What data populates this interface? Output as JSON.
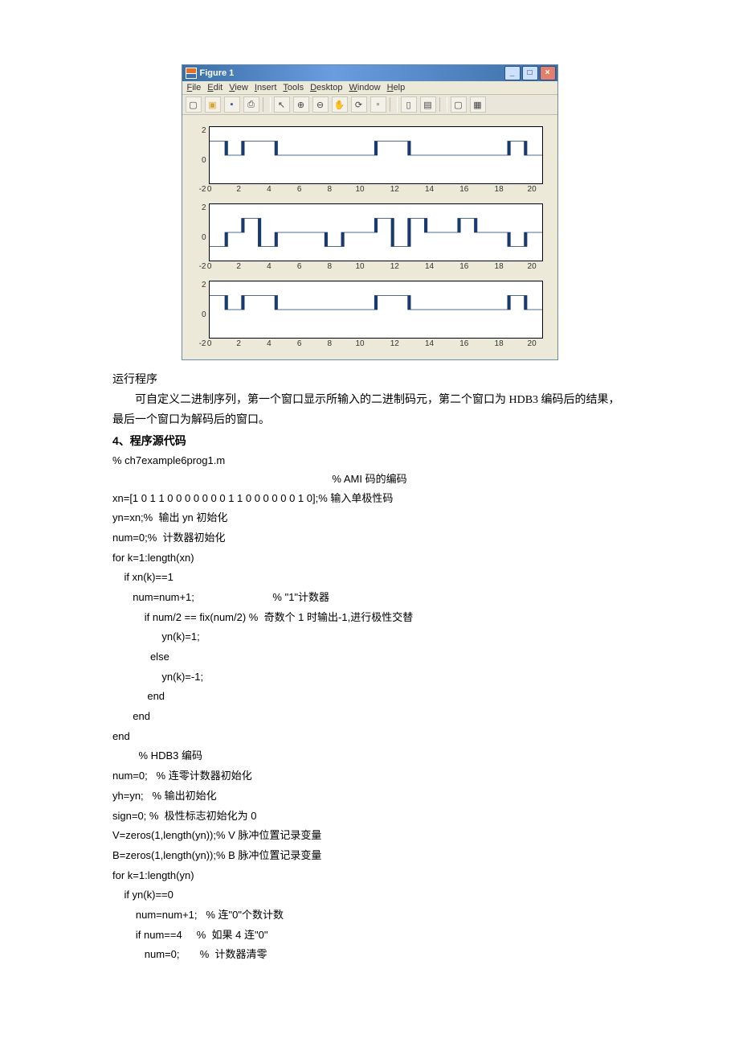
{
  "figure": {
    "title": "Figure 1",
    "menubar": [
      "File",
      "Edit",
      "View",
      "Insert",
      "Tools",
      "Desktop",
      "Window",
      "Help"
    ],
    "toolbar_icons": [
      "new-file-icon",
      "open-icon",
      "save-icon",
      "print-icon",
      "pointer-icon",
      "zoom-in-icon",
      "zoom-out-icon",
      "pan-icon",
      "rotate-icon",
      "data-cursor-icon",
      "colorbar-icon",
      "legend-icon",
      "hide-plot-tools-icon",
      "show-plot-tools-icon"
    ],
    "winbtns": {
      "min": "_",
      "max": "□",
      "close": "×"
    }
  },
  "chart_data": [
    {
      "type": "line",
      "title": "",
      "xlabel": "",
      "ylabel": "",
      "xlim": [
        0,
        20
      ],
      "ylim": [
        -2,
        2
      ],
      "xticks": [
        0,
        2,
        4,
        6,
        8,
        10,
        12,
        14,
        16,
        18,
        20
      ],
      "yticks": [
        -2,
        0,
        2
      ],
      "x": [
        0,
        1,
        1,
        2,
        2,
        3,
        3,
        4,
        4,
        5,
        5,
        6,
        6,
        7,
        7,
        8,
        8,
        9,
        9,
        10,
        10,
        11,
        11,
        12,
        12,
        13,
        13,
        14,
        14,
        15,
        15,
        16,
        16,
        17,
        17,
        18,
        18,
        19,
        19,
        20
      ],
      "y": [
        1,
        1,
        0,
        0,
        1,
        1,
        1,
        1,
        0,
        0,
        0,
        0,
        0,
        0,
        0,
        0,
        0,
        0,
        0,
        0,
        1,
        1,
        1,
        1,
        0,
        0,
        0,
        0,
        0,
        0,
        0,
        0,
        0,
        0,
        0,
        0,
        1,
        1,
        0,
        0
      ]
    },
    {
      "type": "line",
      "title": "",
      "xlabel": "",
      "ylabel": "",
      "xlim": [
        0,
        20
      ],
      "ylim": [
        -2,
        2
      ],
      "xticks": [
        0,
        2,
        4,
        6,
        8,
        10,
        12,
        14,
        16,
        18,
        20
      ],
      "yticks": [
        -2,
        0,
        2
      ],
      "x": [
        0,
        1,
        1,
        2,
        2,
        3,
        3,
        4,
        4,
        5,
        5,
        6,
        6,
        7,
        7,
        8,
        8,
        9,
        9,
        10,
        10,
        11,
        11,
        12,
        12,
        13,
        13,
        14,
        14,
        15,
        15,
        16,
        16,
        17,
        17,
        18,
        18,
        19,
        19,
        20
      ],
      "y": [
        -1,
        -1,
        0,
        0,
        1,
        1,
        -1,
        -1,
        0,
        0,
        0,
        0,
        0,
        0,
        -1,
        -1,
        0,
        0,
        0,
        0,
        1,
        1,
        -1,
        -1,
        1,
        1,
        0,
        0,
        0,
        0,
        1,
        1,
        0,
        0,
        0,
        0,
        -1,
        -1,
        0,
        0
      ]
    },
    {
      "type": "line",
      "title": "",
      "xlabel": "",
      "ylabel": "",
      "xlim": [
        0,
        20
      ],
      "ylim": [
        -2,
        2
      ],
      "xticks": [
        0,
        2,
        4,
        6,
        8,
        10,
        12,
        14,
        16,
        18,
        20
      ],
      "yticks": [
        -2,
        0,
        2
      ],
      "x": [
        0,
        1,
        1,
        2,
        2,
        3,
        3,
        4,
        4,
        5,
        5,
        6,
        6,
        7,
        7,
        8,
        8,
        9,
        9,
        10,
        10,
        11,
        11,
        12,
        12,
        13,
        13,
        14,
        14,
        15,
        15,
        16,
        16,
        17,
        17,
        18,
        18,
        19,
        19,
        20
      ],
      "y": [
        1,
        1,
        0,
        0,
        1,
        1,
        1,
        1,
        0,
        0,
        0,
        0,
        0,
        0,
        0,
        0,
        0,
        0,
        0,
        0,
        1,
        1,
        1,
        1,
        0,
        0,
        0,
        0,
        0,
        0,
        0,
        0,
        0,
        0,
        0,
        0,
        1,
        1,
        0,
        0
      ]
    }
  ],
  "text": {
    "run": "运行程序",
    "desc": "可自定义二进制序列，第一个窗口显示所输入的二进制码元，第二个窗口为 HDB3 编码后的结果，最后一个窗口为解码后的窗口。",
    "heading4": "4、程序源代码",
    "file": "% ch7example6prog1.m",
    "ami_title": "% AMI 码的编码",
    "code_lines": [
      "xn=[1 0 1 1 0 0 0 0 0 0 0 1 1 0 0 0 0 0 0 1 0];% 输入单极性码",
      "yn=xn;%  输出 yn 初始化",
      "num=0;%  计数器初始化",
      "for k=1:length(xn)",
      "    if xn(k)==1",
      "       num=num+1;                           % \"1\"计数器",
      "           if num/2 == fix(num/2) %  奇数个 1 时输出-1,进行极性交替",
      "                 yn(k)=1;",
      "             else",
      "                 yn(k)=-1;",
      "            end",
      "       end",
      "end",
      "         % HDB3 编码",
      "num=0;   % 连零计数器初始化",
      "yh=yn;   % 输出初始化",
      "sign=0; %  极性标志初始化为 0",
      "V=zeros(1,length(yn));% V 脉冲位置记录变量",
      "B=zeros(1,length(yn));% B 脉冲位置记录变量",
      "for k=1:length(yn)",
      "    if yn(k)==0",
      "        num=num+1;   % 连\"0\"个数计数",
      "        if num==4     %  如果 4 连\"0\"",
      "           num=0;       %  计数器清零"
    ]
  }
}
